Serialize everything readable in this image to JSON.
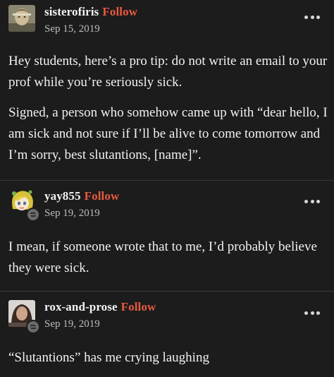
{
  "follow_label": "Follow",
  "colors": {
    "background": "#1c1c1c",
    "follow_accent": "#e85a40",
    "divider": "#3a3a3a",
    "date_text": "#bdbdbd"
  },
  "posts": [
    {
      "username": "sisterofiris",
      "date": "Sep 15, 2019",
      "reblog": false,
      "avatar_icon": "user-avatar-icon",
      "paragraphs": [
        "Hey students, here’s a pro tip: do not write an email to your prof while you’re seriously sick.",
        "Signed, a person who somehow came up with “dear hello, I am sick and not sure if I’ll be alive to come tomorrow and I’m sorry, best slutantions, [name]”."
      ]
    },
    {
      "username": "yay855",
      "date": "Sep 19, 2019",
      "reblog": true,
      "avatar_icon": "anime-avatar-icon",
      "paragraphs": [
        "I mean, if someone wrote that to me, I’d probably believe they were sick."
      ]
    },
    {
      "username": "rox-and-prose",
      "date": "Sep 19, 2019",
      "reblog": true,
      "avatar_icon": "user-avatar-icon",
      "paragraphs": [
        "“Slutantions” has me crying laughing"
      ]
    }
  ]
}
